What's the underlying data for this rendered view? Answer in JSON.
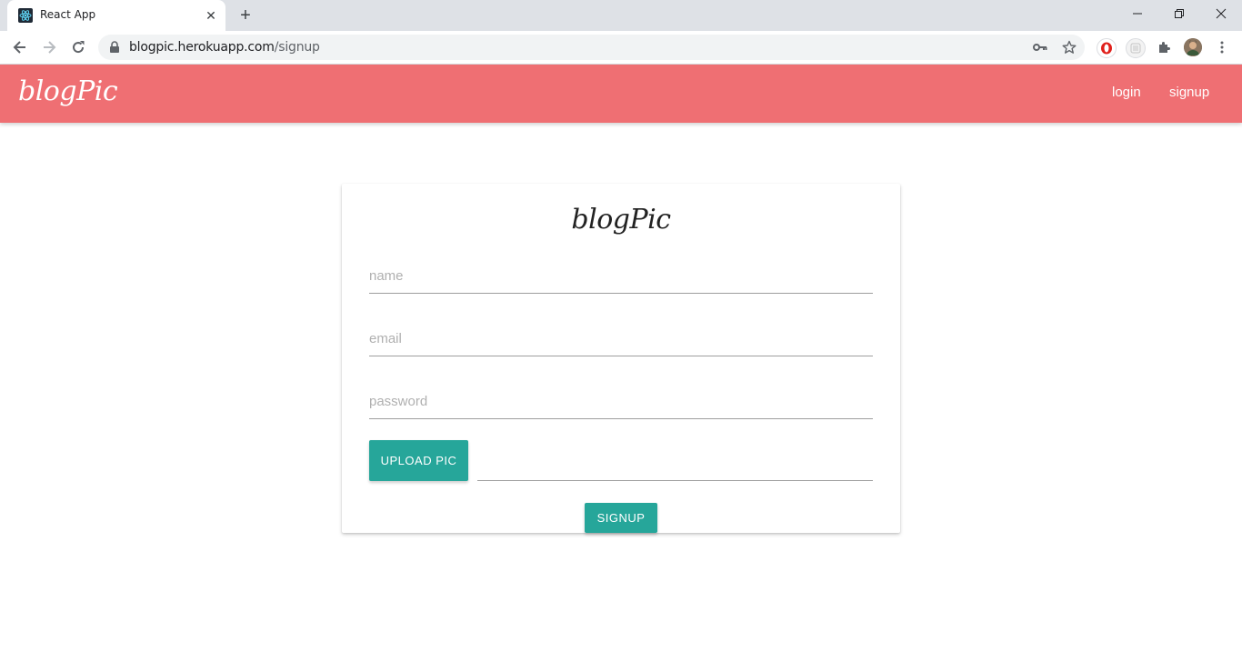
{
  "browser": {
    "tab_title": "React App",
    "url_host": "blogpic.herokuapp.com",
    "url_path": "/signup"
  },
  "navbar": {
    "brand": "blogPic",
    "links": [
      "login",
      "signup"
    ]
  },
  "form": {
    "title": "blogPic",
    "name_placeholder": "name",
    "email_placeholder": "email",
    "password_placeholder": "password",
    "upload_label": "UPLOAD PIC",
    "submit_label": "SIGNUP"
  },
  "colors": {
    "navbar": "#ef6f73",
    "accent": "#26a69a"
  }
}
